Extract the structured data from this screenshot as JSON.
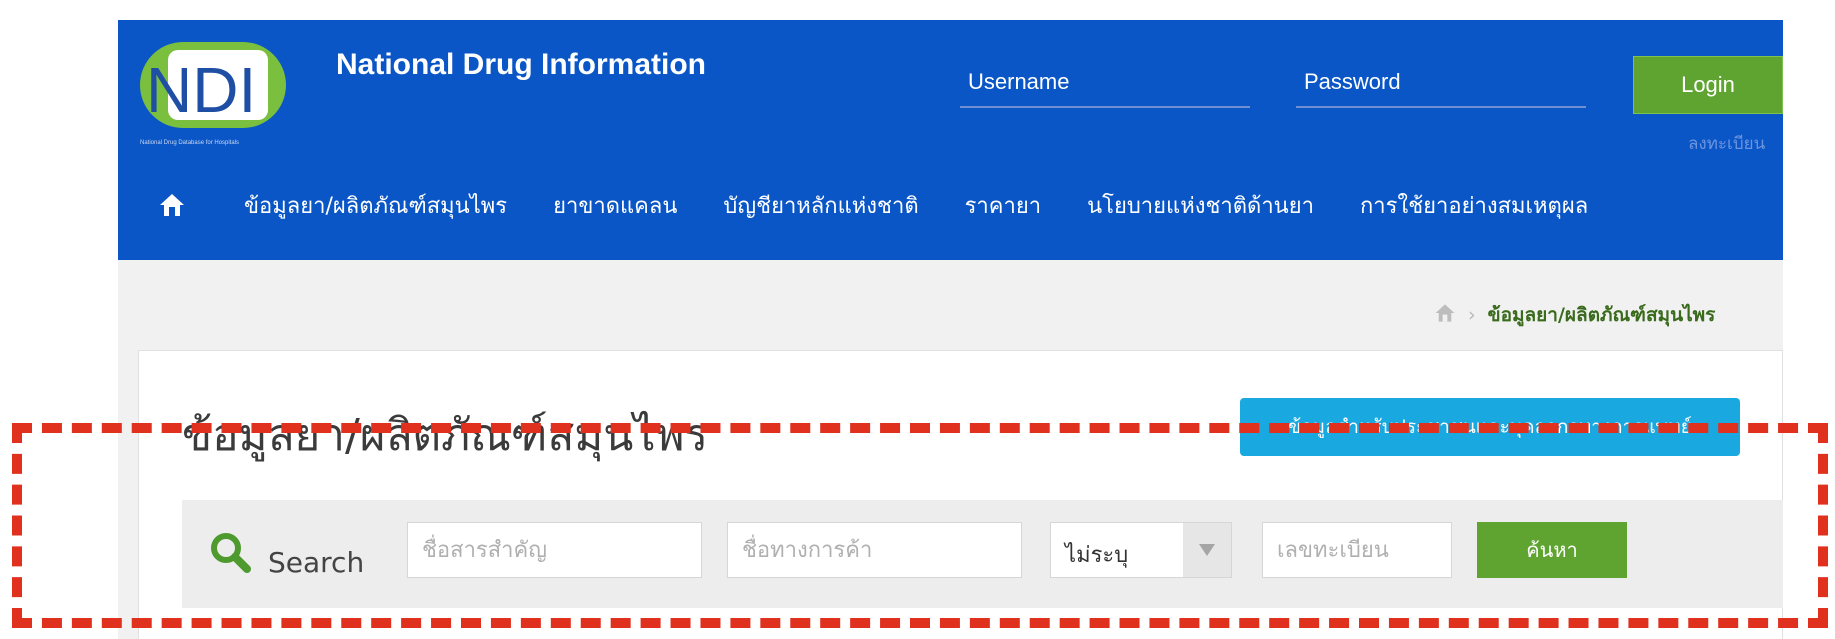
{
  "header": {
    "logo_text": "NDI",
    "logo_subtext": "National Drug Database for Hospitals",
    "brand_title": "National Drug Information",
    "username_placeholder": "Username",
    "password_placeholder": "Password",
    "login_label": "Login",
    "register_label": "ลงทะเบียน"
  },
  "nav": {
    "items": [
      {
        "label": "ข้อมูลยา/ผลิตภัณฑ์สมุนไพร"
      },
      {
        "label": "ยาขาดแคลน"
      },
      {
        "label": "บัญชียาหลักแห่งชาติ"
      },
      {
        "label": "ราคายา"
      },
      {
        "label": "นโยบายแห่งชาติด้านยา"
      },
      {
        "label": "การใช้ยาอย่างสมเหตุผล"
      }
    ]
  },
  "breadcrumb": {
    "separator": "›",
    "current": "ข้อมูลยา/ผลิตภัณฑ์สมุนไพร"
  },
  "page": {
    "title": "ข้อมูลยา/ผลิตภัณฑ์สมุนไพร",
    "info_button": "ข้อมูลสำหรับประชาชนและบุคลากรทางการแพทย์"
  },
  "search": {
    "label": "Search",
    "ingredient_placeholder": "ชื่อสารสำคัญ",
    "trade_placeholder": "ชื่อทางการค้า",
    "select_value": "ไม่ระบุ",
    "registration_placeholder": "เลขทะเบียน",
    "button_label": "ค้นหา"
  },
  "colors": {
    "header_blue": "#0a56c6",
    "accent_green": "#5fa431",
    "info_blue": "#19a9e0",
    "highlight_red": "#e0301e"
  },
  "icons": [
    "home-icon",
    "search-icon",
    "chevron-down-icon"
  ]
}
